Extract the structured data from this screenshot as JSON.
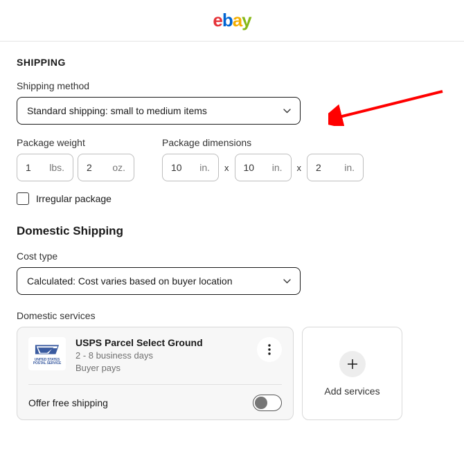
{
  "logo": {
    "e": "e",
    "b": "b",
    "a": "a",
    "y": "y"
  },
  "shipping": {
    "title": "SHIPPING",
    "method_label": "Shipping method",
    "method_value": "Standard shipping: small to medium items",
    "weight_label": "Package weight",
    "weight_lbs": "1",
    "weight_oz": "2",
    "unit_lbs": "lbs.",
    "unit_oz": "oz.",
    "dims_label": "Package dimensions",
    "dim_l": "10",
    "dim_w": "10",
    "dim_h": "2",
    "unit_in": "in.",
    "dim_x": "x",
    "irregular_label": "Irregular package"
  },
  "domestic": {
    "title": "Domestic Shipping",
    "cost_label": "Cost type",
    "cost_value": "Calculated: Cost varies based on buyer location",
    "services_label": "Domestic services",
    "service": {
      "name": "USPS Parcel Select Ground",
      "time": "2 - 8 business days",
      "payer": "Buyer pays",
      "usps_line1": "UNITED STATES",
      "usps_line2": "POSTAL SERVICE"
    },
    "offer_free": "Offer free shipping",
    "add_services": "Add services"
  },
  "colors": {
    "arrow": "#ff0000",
    "border_dark": "#191919",
    "border_light": "#bdbdbd"
  }
}
